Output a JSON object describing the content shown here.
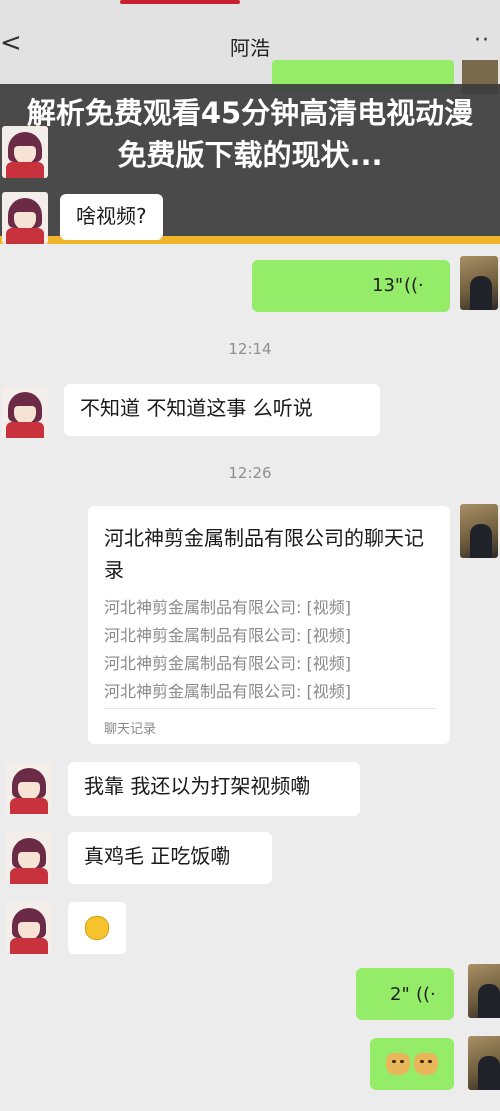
{
  "header": {
    "back_glyph": "<",
    "title": "阿浩",
    "more_glyph": "··"
  },
  "overlay": {
    "headline": "解析免费观看45分钟高清电视动漫免费版下载的现状..."
  },
  "messages": {
    "q_video": "啥视频?",
    "voice_1_duration": "13\"",
    "time_1": "12:14",
    "msg_dont_know": "不知道 不知道这事 么听说",
    "time_2": "12:26",
    "card": {
      "title": "河北神剪金属制品有限公司的聊天记录",
      "lines": [
        "河北神剪金属制品有限公司: [视频]",
        "河北神剪金属制品有限公司: [视频]",
        "河北神剪金属制品有限公司: [视频]",
        "河北神剪金属制品有限公司: [视频]"
      ],
      "footer": "聊天记录"
    },
    "msg_fight": "我靠 我还以为打架视频嘞",
    "msg_eating": "真鸡毛 正吃饭嘞",
    "voice_2_duration": "2\""
  },
  "colors": {
    "green_bubble": "#95ec69",
    "overlay_bar": "#f0b62a",
    "chat_bg": "#ececec"
  },
  "icons": {
    "voice": "voice-wave-icon",
    "laugh": "laughing-emoji-icon",
    "doge": "doge-sticker-icon"
  }
}
